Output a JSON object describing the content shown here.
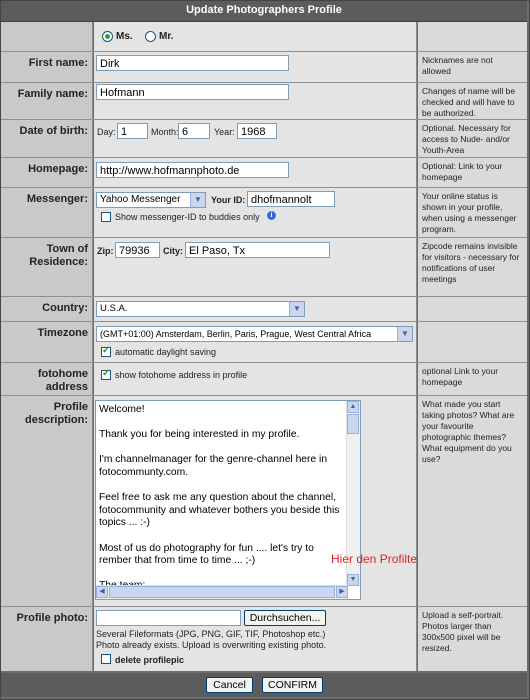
{
  "title": "Update Photographers Profile",
  "gender": {
    "options": [
      "Ms.",
      "Mr."
    ],
    "selected": "Ms."
  },
  "first_name": {
    "label": "First name:",
    "value": "Dirk",
    "hint": "Nicknames are not allowed"
  },
  "family_name": {
    "label": "Family name:",
    "value": "Hofmann",
    "hint": "Changes of name will be checked and will have to be authorized."
  },
  "dob": {
    "label": "Date of birth:",
    "day_label": "Day:",
    "day": "1",
    "month_label": "Month:",
    "month": "6",
    "year_label": "Year:",
    "year": "1968",
    "hint": "Optional. Necessary for access to Nude- and/or Youth-Area"
  },
  "homepage": {
    "label": "Homepage:",
    "value": "http://www.hofmannphoto.de",
    "hint": "Optional: Link to your homepage"
  },
  "messenger": {
    "label": "Messenger:",
    "selected": "Yahoo Messenger",
    "id_label": "Your ID:",
    "id_value": "dhofmannolt",
    "show_label": "Show messenger-ID to buddies only",
    "show_checked": false,
    "hint": "Your online status is shown in your profile, when using a messenger program."
  },
  "town": {
    "label": "Town of Residence:",
    "zip_label": "Zip:",
    "zip": "79936",
    "city_label": "City:",
    "city": "El Paso, Tx",
    "hint": "Zipcode remains invisible for visitors - necessary for notifications of user meetings"
  },
  "country": {
    "label": "Country:",
    "selected": "U.S.A."
  },
  "timezone": {
    "label": "Timezone",
    "selected": "(GMT+01:00) Amsterdam, Berlin, Paris, Prague, West Central Africa",
    "dst_label": "automatic daylight saving",
    "dst_checked": true
  },
  "fotohome": {
    "label": "fotohome address",
    "show_label": "show fotohome address in profile",
    "checked": true,
    "hint": "optional Link to your homepage"
  },
  "description": {
    "label": "Profile description:",
    "text": "Welcome!\n\nThank you for being interested in my profile.\n\nI'm channelmanager for the genre-channel here in fotocommunty.com.\n\nFeel free to ask me any question about the channel, fotocommunity and whatever bothers you beside this topics ... :-)\n\nMost of us do photography for fun .... let's try to rember that from time to time ... ;-)\n\nThe team:",
    "annotation": "Hier den Profiltext eintragen.",
    "hint": "What made you start taking photos? What are your favourite photographic themes? What equipment do you use?"
  },
  "photo": {
    "label": "Profile photo:",
    "browse_label": "Durchsuchen...",
    "formats": "Several Fileformats (JPG, PNG, GIF, TIF, Photoshop etc.)",
    "exists": "Photo already exists. Upload is overwriting existing photo.",
    "delete_label": "delete profilepic",
    "delete_checked": false,
    "hint": "Upload a self-portrait. Photos larger than 300x500 pixel will be resized."
  },
  "buttons": {
    "cancel": "Cancel",
    "confirm": "CONFIRM"
  },
  "colors": {
    "annotation": "#e21f26",
    "title_bg": "#5c5c5c",
    "label_bg": "#c9c9c9",
    "field_bg": "#e4e4e4"
  }
}
